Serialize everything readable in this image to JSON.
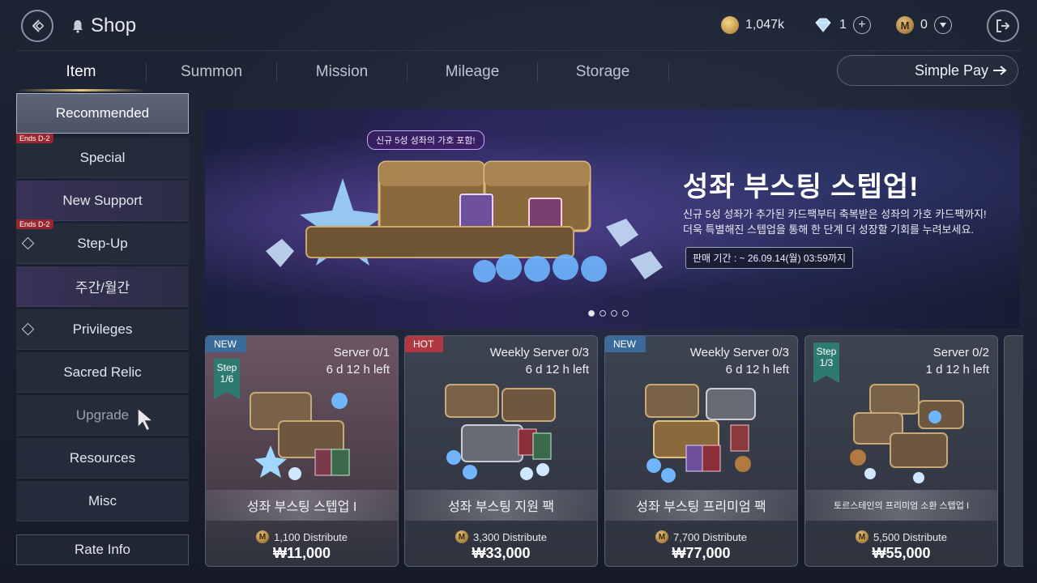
{
  "header": {
    "title": "Shop",
    "currencies": [
      {
        "value": "1,047k",
        "icon": "gold-coin-icon"
      },
      {
        "value": "1",
        "icon": "crystal-icon"
      },
      {
        "value": "0",
        "icon": "m-coin-icon"
      }
    ]
  },
  "tabs": [
    {
      "label": "Item",
      "active": true
    },
    {
      "label": "Summon"
    },
    {
      "label": "Mission"
    },
    {
      "label": "Mileage"
    },
    {
      "label": "Storage"
    }
  ],
  "simple_pay": {
    "label": "Simple Pay"
  },
  "sidebar": {
    "items": [
      {
        "label": "Recommended"
      },
      {
        "label": "Special",
        "ends": "Ends D-2"
      },
      {
        "label": "New Support"
      },
      {
        "label": "Step-Up",
        "ends": "Ends D-2"
      },
      {
        "label": "주간/월간"
      },
      {
        "label": "Privileges"
      },
      {
        "label": "Sacred Relic"
      },
      {
        "label": "Upgrade"
      },
      {
        "label": "Resources"
      },
      {
        "label": "Misc"
      }
    ],
    "rate_info": "Rate Info"
  },
  "banner": {
    "tag": "신규 5성 성좌의 가호 포함!",
    "title": "성좌 부스팅 스텝업!",
    "desc_line1": "신규 5성 성좌가 추가된 카드팩부터 축복받은 성좌의 가호 카드팩까지!",
    "desc_line2": "더욱 특별해진 스텝업을 통해 한 단계 더 성장할 기회를 누려보세요.",
    "period": "판매 기간 : ~ 26.09.14(월) 03:59까지",
    "active_dot": 0
  },
  "cards": [
    {
      "badge": "NEW",
      "limit1": "Server 0/1",
      "limit2": "6 d 12 h left",
      "step1": "Step",
      "step2": "1/6",
      "name": "성좌 부스팅 스텝업 I",
      "dist": "1,100 Distribute",
      "price": "₩11,000"
    },
    {
      "badge": "HOT",
      "limit1": "Weekly Server 0/3",
      "limit2": "6 d 12 h left",
      "name": "성좌 부스팅 지원 팩",
      "dist": "3,300 Distribute",
      "price": "₩33,000"
    },
    {
      "badge": "NEW",
      "limit1": "Weekly Server 0/3",
      "limit2": "6 d 12 h left",
      "name": "성좌 부스팅 프리미엄 팩",
      "dist": "7,700 Distribute",
      "price": "₩77,000"
    },
    {
      "limit1": "Server 0/2",
      "limit2": "1 d 12 h left",
      "step1": "Step",
      "step2": "1/3",
      "name": "토르스테인의 프리미엄 소환 스텝업 I",
      "dist": "5,500 Distribute",
      "price": "₩55,000"
    }
  ],
  "m_coin_letter": "M"
}
